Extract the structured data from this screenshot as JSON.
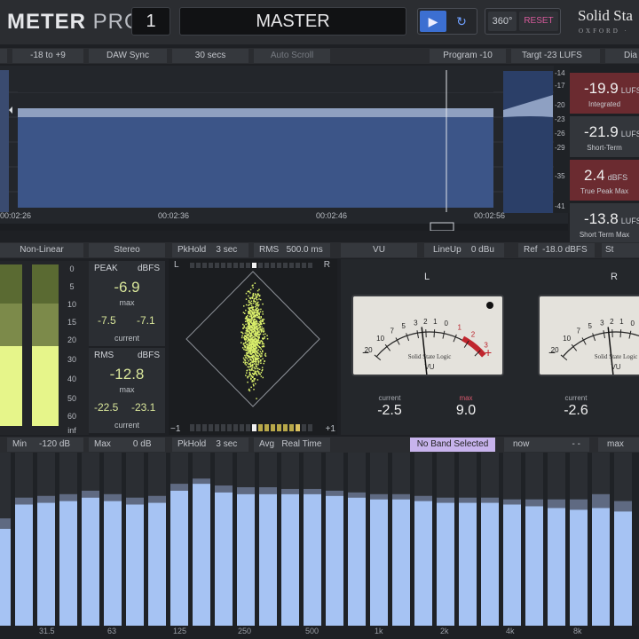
{
  "app": {
    "name_bold": "METER",
    "name_light": "PRO",
    "brand": "Solid Sta",
    "brand_sub": "OXFORD ·"
  },
  "header": {
    "track_number": "1",
    "track_name": "MASTER",
    "btn_360": "360°",
    "btn_reset": "RESET"
  },
  "loudness_toolbar": {
    "range": "-18 to +9",
    "sync": "DAW Sync",
    "window": "30 secs",
    "autoscroll": "Auto Scroll",
    "program": "Program -10",
    "target": "Targt  -23 LUFS",
    "dial": "Dia"
  },
  "history": {
    "times": [
      "00:02:26",
      "00:02:36",
      "00:02:46",
      "00:02:56"
    ],
    "scale": [
      "-14",
      "-17",
      "-20",
      "-23",
      "-26",
      "-29",
      "-35",
      "-41"
    ],
    "short_term_profile": [
      -16.8,
      -17.0,
      -16.9,
      -17.2,
      -16.7,
      -16.5,
      -16.9,
      -17.1,
      -16.8,
      -16.6,
      -16.9,
      -17.3,
      -16.9,
      -16.6,
      -16.8,
      -17.0,
      -16.7,
      -16.6,
      -16.9,
      -17.1,
      -16.8,
      -16.7,
      -17.0,
      -16.8,
      -16.5,
      -16.7
    ]
  },
  "loudness": [
    {
      "value": "-19.9",
      "unit": "LUFS",
      "label": "Integrated",
      "color": "#6b2b30"
    },
    {
      "value": "-21.9",
      "unit": "LUFS",
      "label": "Short-Term",
      "color": "#33363b"
    },
    {
      "value": "2.4",
      "unit": "dBFS",
      "label": "True Peak Max",
      "color": "#6b2b30"
    },
    {
      "value": "-13.8",
      "unit": "LUFS",
      "label": "Short Term Max",
      "color": "#33363b"
    }
  ],
  "meter_toolbar": {
    "mode": "Non-Linear",
    "stereo": "Stereo",
    "pkhold": "PkHold",
    "pkhold_val": "3 sec",
    "rms": "RMS",
    "rms_val": "500.0 ms",
    "vu": "VU",
    "lineup": "LineUp",
    "lineup_val": "0 dBu",
    "ref": "Ref",
    "ref_val": "-18.0 dBFS",
    "st": "St"
  },
  "ppm": {
    "scale": [
      "0",
      "5",
      "10",
      "15",
      "20",
      "30",
      "40",
      "50",
      "60",
      "inf"
    ],
    "levels": [
      0.55,
      0.55
    ]
  },
  "peak": {
    "title": "PEAK",
    "unit": "dBFS",
    "max": "-6.9",
    "max_label": "max",
    "cur_l": "-7.5",
    "cur_r": "-7.1",
    "cur_label": "current"
  },
  "rms_box": {
    "title": "RMS",
    "unit": "dBFS",
    "max": "-12.8",
    "max_label": "max",
    "cur_l": "-22.5",
    "cur_r": "-23.1",
    "cur_label": "current"
  },
  "vector": {
    "left": "L",
    "right": "R",
    "minus": "−1",
    "plus": "+1"
  },
  "vu": {
    "left": {
      "channel": "L",
      "current_label": "current",
      "current": "-2.5",
      "max_label": "max",
      "max": "9.0"
    },
    "right": {
      "channel": "R",
      "current_label": "current",
      "current": "-2.6"
    },
    "face_text": "Solid State Logic",
    "face_vu": "VU",
    "scale": [
      "20",
      "10",
      "7",
      "5",
      "3",
      "2",
      "1",
      "0",
      "1",
      "2",
      "3"
    ]
  },
  "spectrum_toolbar": {
    "min": "Min",
    "min_val": "-120 dB",
    "max": "Max",
    "max_val": "0 dB",
    "pkhold": "PkHold",
    "pkhold_val": "3 sec",
    "avg": "Avg",
    "avg_val": "Real Time",
    "band": "No Band Selected",
    "now": "now",
    "dashes": "- -",
    "maxbtn": "max"
  },
  "spectrum": {
    "freq_labels": [
      "31.5",
      "63",
      "125",
      "250",
      "500",
      "1k",
      "2k",
      "4k",
      "8k"
    ],
    "bars": [
      0.56,
      0.7,
      0.71,
      0.72,
      0.74,
      0.72,
      0.7,
      0.71,
      0.78,
      0.82,
      0.77,
      0.76,
      0.76,
      0.76,
      0.76,
      0.75,
      0.74,
      0.73,
      0.73,
      0.72,
      0.71,
      0.71,
      0.71,
      0.7,
      0.69,
      0.68,
      0.67,
      0.68,
      0.66
    ],
    "holds": [
      0.62,
      0.74,
      0.75,
      0.76,
      0.78,
      0.76,
      0.74,
      0.75,
      0.82,
      0.85,
      0.81,
      0.8,
      0.8,
      0.79,
      0.79,
      0.78,
      0.77,
      0.76,
      0.76,
      0.75,
      0.74,
      0.74,
      0.74,
      0.73,
      0.73,
      0.73,
      0.73,
      0.76,
      0.72
    ]
  }
}
